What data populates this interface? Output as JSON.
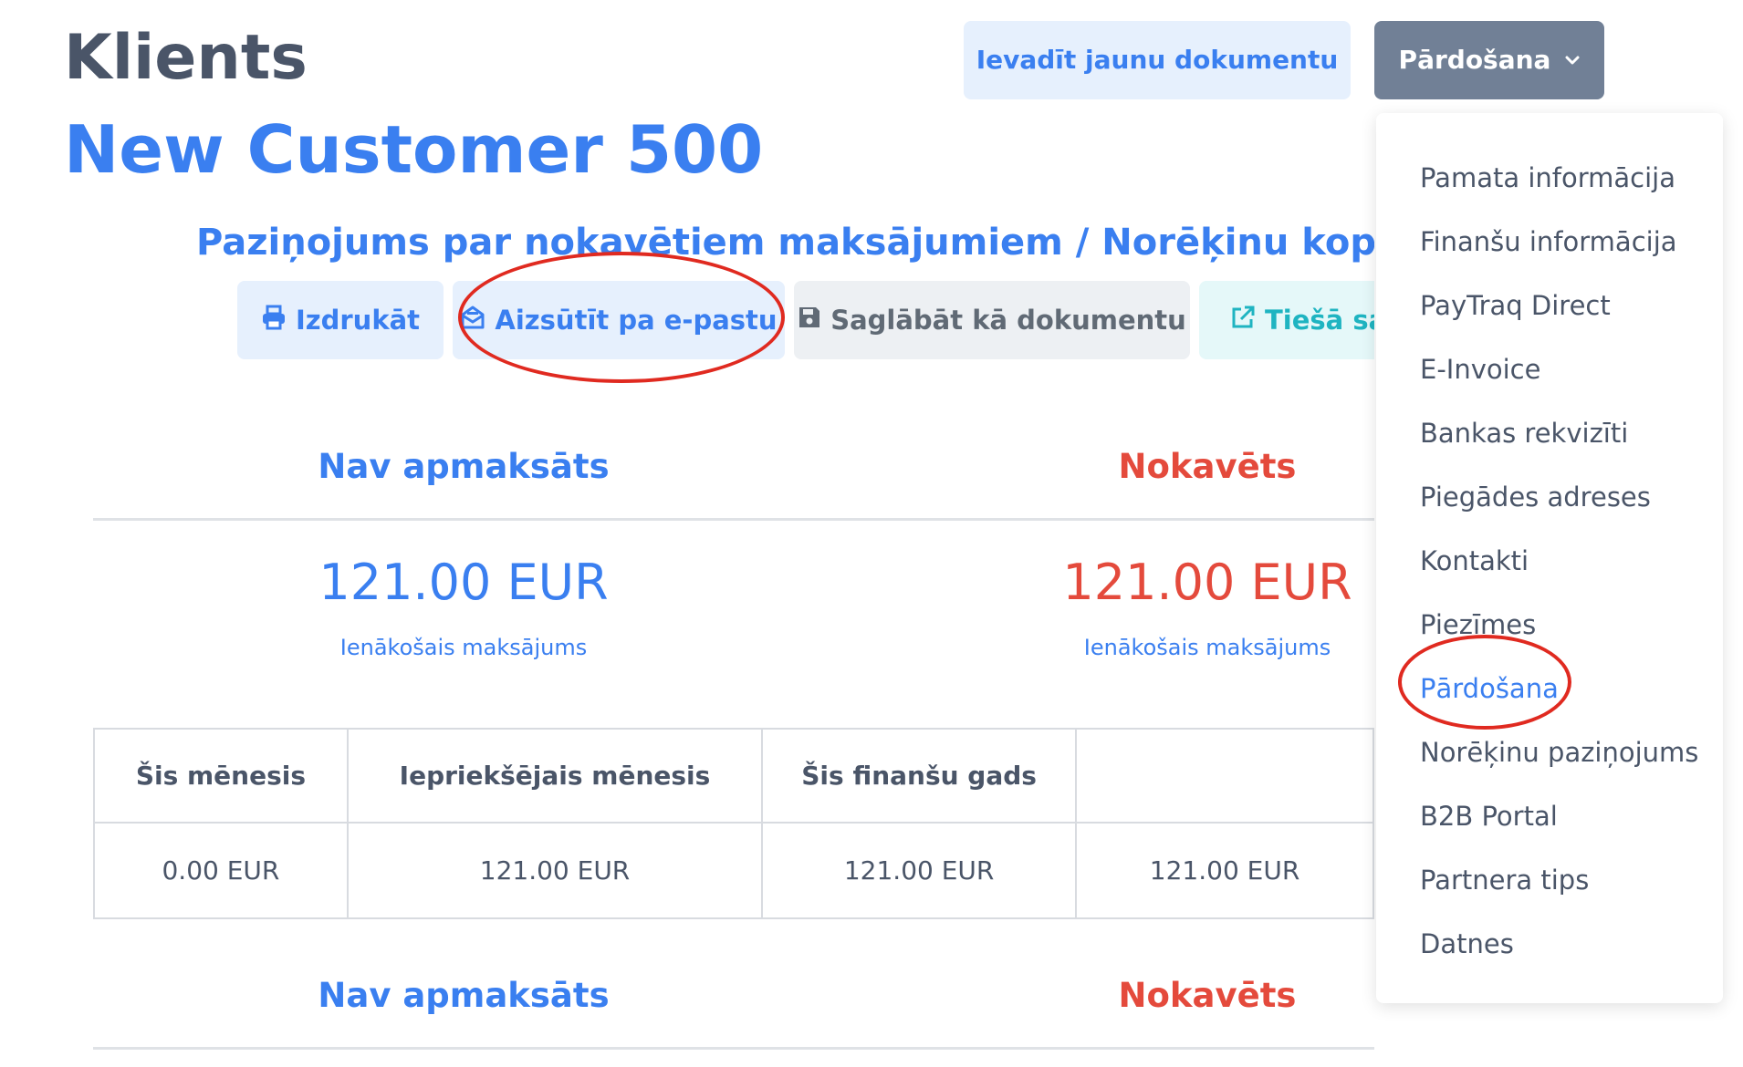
{
  "header": {
    "page_label": "Klients",
    "customer_name": "New Customer 500",
    "new_document_button": "Ievadīt jaunu dokumentu",
    "sales_button": "Pārdošana"
  },
  "statement": {
    "title": "Paziņojums par nokavētiem maksājumiem / Norēķinu kopsavilkums",
    "actions": {
      "print": "Izdrukāt",
      "email": "Aizsūtīt pa e-pastu",
      "save": "Saglābāt kā dokumentu",
      "direct_link": "Tiešā saite"
    }
  },
  "summary": {
    "unpaid": {
      "heading": "Nav apmaksāts",
      "amount": "121.00 EUR",
      "sub": "Ienākošais maksājums"
    },
    "overdue": {
      "heading": "Nokavēts",
      "amount": "121.00 EUR",
      "sub": "Ienākošais maksājums"
    }
  },
  "periods": {
    "headers": [
      "Šis mēnesis",
      "Iepriekšējais mēnesis",
      "Šis finanšu gads",
      ""
    ],
    "values": [
      "0.00 EUR",
      "121.00 EUR",
      "121.00 EUR",
      "121.00 EUR"
    ]
  },
  "summary2": {
    "unpaid_heading": "Nav apmaksāts",
    "overdue_heading": "Nokavēts"
  },
  "menu": {
    "items": [
      {
        "label": "Pamata informācija",
        "active": false
      },
      {
        "label": "Finanšu informācija",
        "active": false
      },
      {
        "label": "PayTraq Direct",
        "active": false
      },
      {
        "label": "E-Invoice",
        "active": false
      },
      {
        "label": "Bankas rekvizīti",
        "active": false
      },
      {
        "label": "Piegādes adreses",
        "active": false
      },
      {
        "label": "Kontakti",
        "active": false
      },
      {
        "label": "Piezīmes",
        "active": false
      },
      {
        "label": "Pārdošana",
        "active": true
      },
      {
        "label": "Norēķinu paziņojums",
        "active": false
      },
      {
        "label": "B2B Portal",
        "active": false
      },
      {
        "label": "Partnera tips",
        "active": false
      },
      {
        "label": "Datnes",
        "active": false
      }
    ]
  },
  "icons": {
    "print": "printer-icon",
    "email": "envelope-open-icon",
    "save": "floppy-disk-icon",
    "direct_link": "external-link-icon",
    "sales_dropdown": "chevron-down-icon"
  },
  "colors": {
    "primary": "#3a7ff0",
    "danger": "#e44a3c",
    "muted": "#4a5568",
    "dropdown_button": "#718096",
    "annotation": "#e02a20"
  }
}
